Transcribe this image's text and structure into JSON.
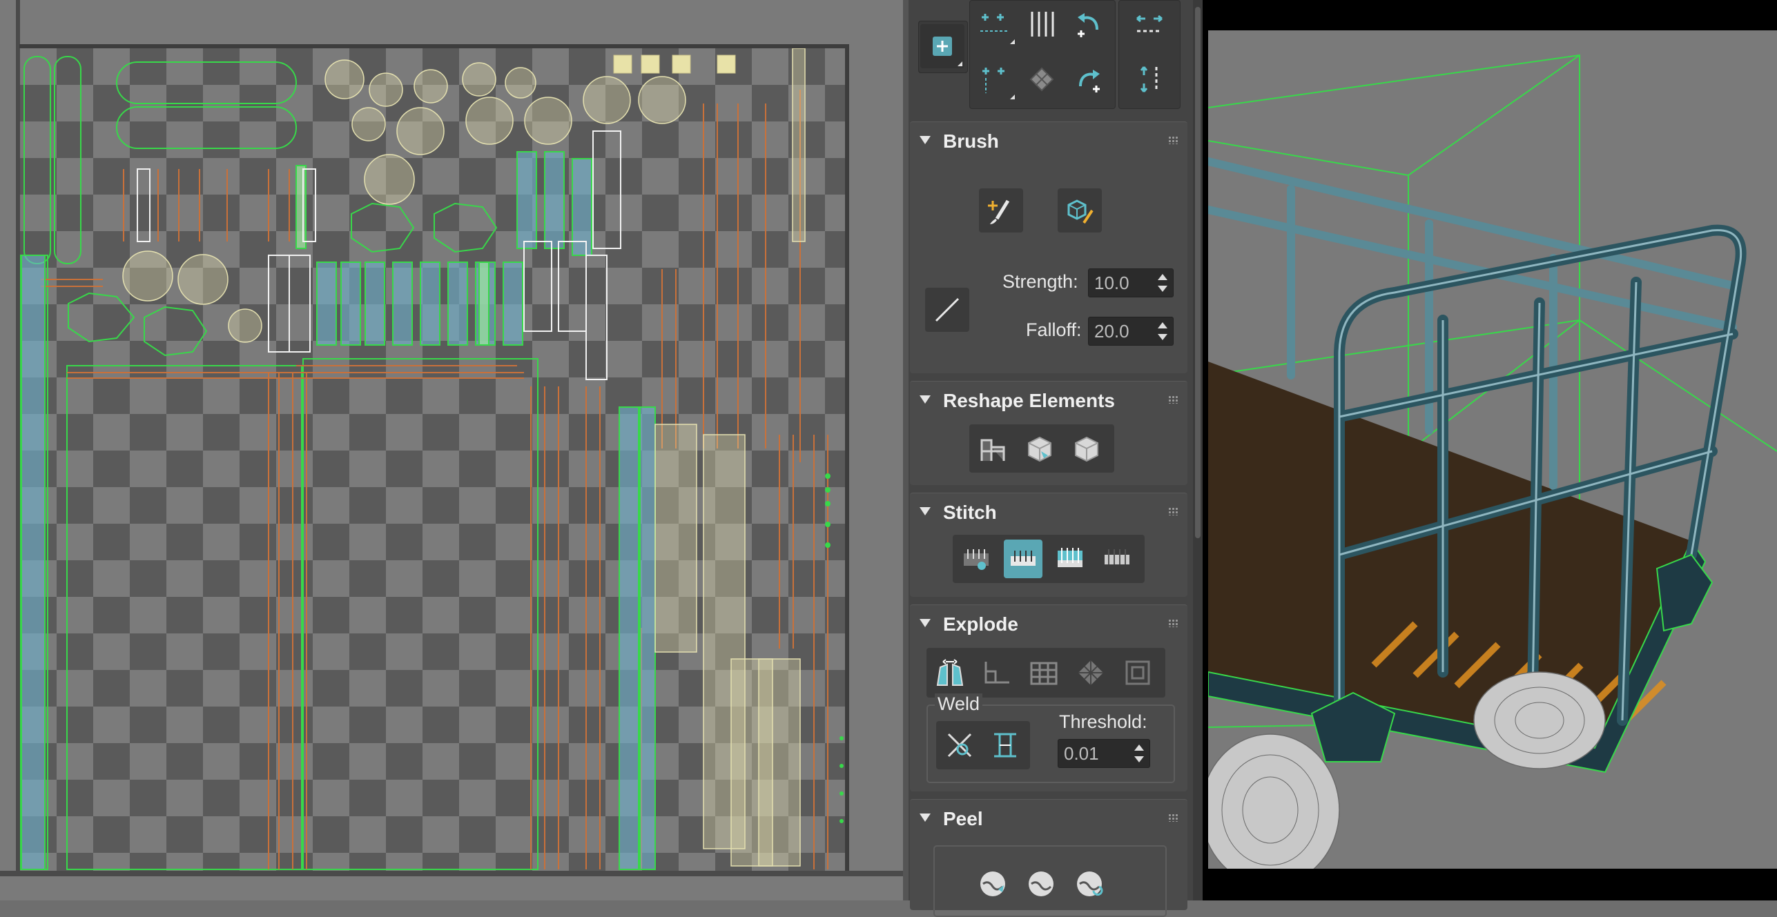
{
  "uv_editor": {
    "name": "uv-editor"
  },
  "toolbar": {
    "tools": [
      {
        "id": "break",
        "icon": "break-verts-icon"
      },
      {
        "id": "split",
        "icon": "split-edges-icon"
      },
      {
        "id": "rotate-ccw",
        "icon": "rotate-ccw-icon"
      },
      {
        "id": "stretch-h",
        "icon": "stretch-horizontal-icon"
      },
      {
        "id": "add-verts",
        "icon": "add-verts-icon"
      },
      {
        "id": "relax",
        "icon": "relax-icon"
      },
      {
        "id": "rotate-cw",
        "icon": "rotate-cw-icon"
      },
      {
        "id": "stretch-v",
        "icon": "stretch-vertical-icon"
      },
      {
        "id": "freeform",
        "icon": "freeform-mode-icon"
      }
    ]
  },
  "brush": {
    "title": "Brush",
    "strength_label": "Strength:",
    "strength_value": "10.0",
    "falloff_label": "Falloff:",
    "falloff_value": "20.0",
    "buttons": [
      "paint-move-icon",
      "paint-relax-icon",
      "falloff-type-icon"
    ]
  },
  "reshape": {
    "title": "Reshape Elements",
    "buttons": [
      "straighten-icon",
      "relax-element-icon",
      "relax-by-face-icon"
    ]
  },
  "stitch": {
    "title": "Stitch",
    "buttons": [
      "stitch-custom-icon",
      "stitch-to-target-icon",
      "stitch-to-average-icon",
      "stitch-to-source-icon"
    ],
    "active_color": "#5aa7b4"
  },
  "explode": {
    "title": "Explode",
    "buttons": [
      "flatten-by-smoothing-icon",
      "flatten-by-polygon-angle-icon",
      "flatten-by-material-icon",
      "flatten-by-smoothing-groups-icon",
      "break-icon"
    ],
    "weld_label": "Weld",
    "threshold_label": "Threshold:",
    "threshold_value": "0.01",
    "weld_buttons": [
      "weld-selected-icon",
      "weld-all-icon"
    ]
  },
  "peel": {
    "title": "Peel",
    "buttons": [
      "quick-peel-icon",
      "peel-mode-icon",
      "reset-peel-icon"
    ]
  },
  "viewport": {
    "name": "perspective-viewport"
  },
  "colors": {
    "uv_green": "#38d84a",
    "uv_orange": "#c9713a",
    "uv_blue": "#6fb3cf",
    "uv_yellow": "#e4e0b0",
    "accent": "#5aa7b4"
  }
}
